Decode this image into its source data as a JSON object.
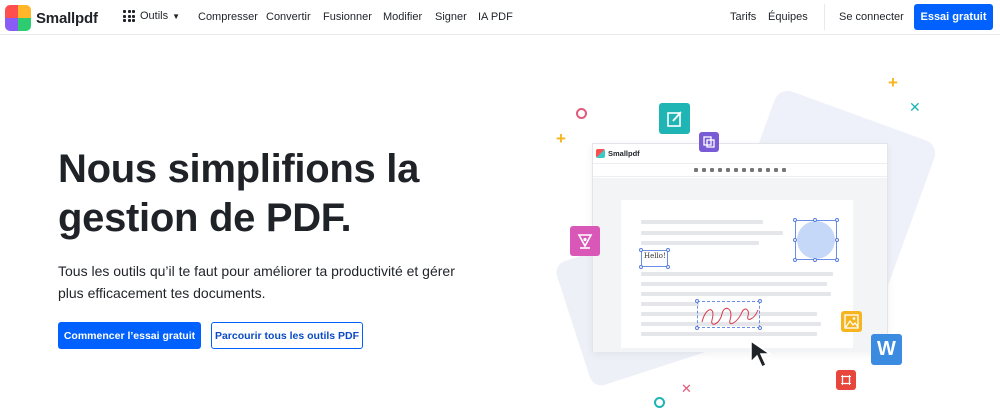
{
  "nav": {
    "brand": "Smallpdf",
    "tools_label": "Outils",
    "links": [
      "Compresser",
      "Convertir",
      "Fusionner",
      "Modifier",
      "Signer",
      "IA PDF"
    ],
    "pricing": "Tarifs",
    "teams": "Équipes",
    "login": "Se connecter",
    "trial": "Essai gratuit"
  },
  "hero": {
    "title": "Nous simplifions la gestion de PDF.",
    "subtitle": "Tous les outils qu’il te faut pour améliorer ta productivité et gérer plus efficacement tes documents.",
    "primary_cta": "Commencer l’essai gratuit",
    "secondary_cta": "Parcourir tous les outils PDF"
  },
  "illustration": {
    "app_name": "Smallpdf",
    "hello_text": "Hello!",
    "word_letter": "W"
  },
  "colors": {
    "accent": "#0061fe",
    "teal": "#1fb5b5",
    "purple": "#7a5bd6",
    "pink": "#d957b6",
    "orange": "#f6b51e",
    "word_blue": "#3b8be0",
    "red": "#e8453c"
  }
}
